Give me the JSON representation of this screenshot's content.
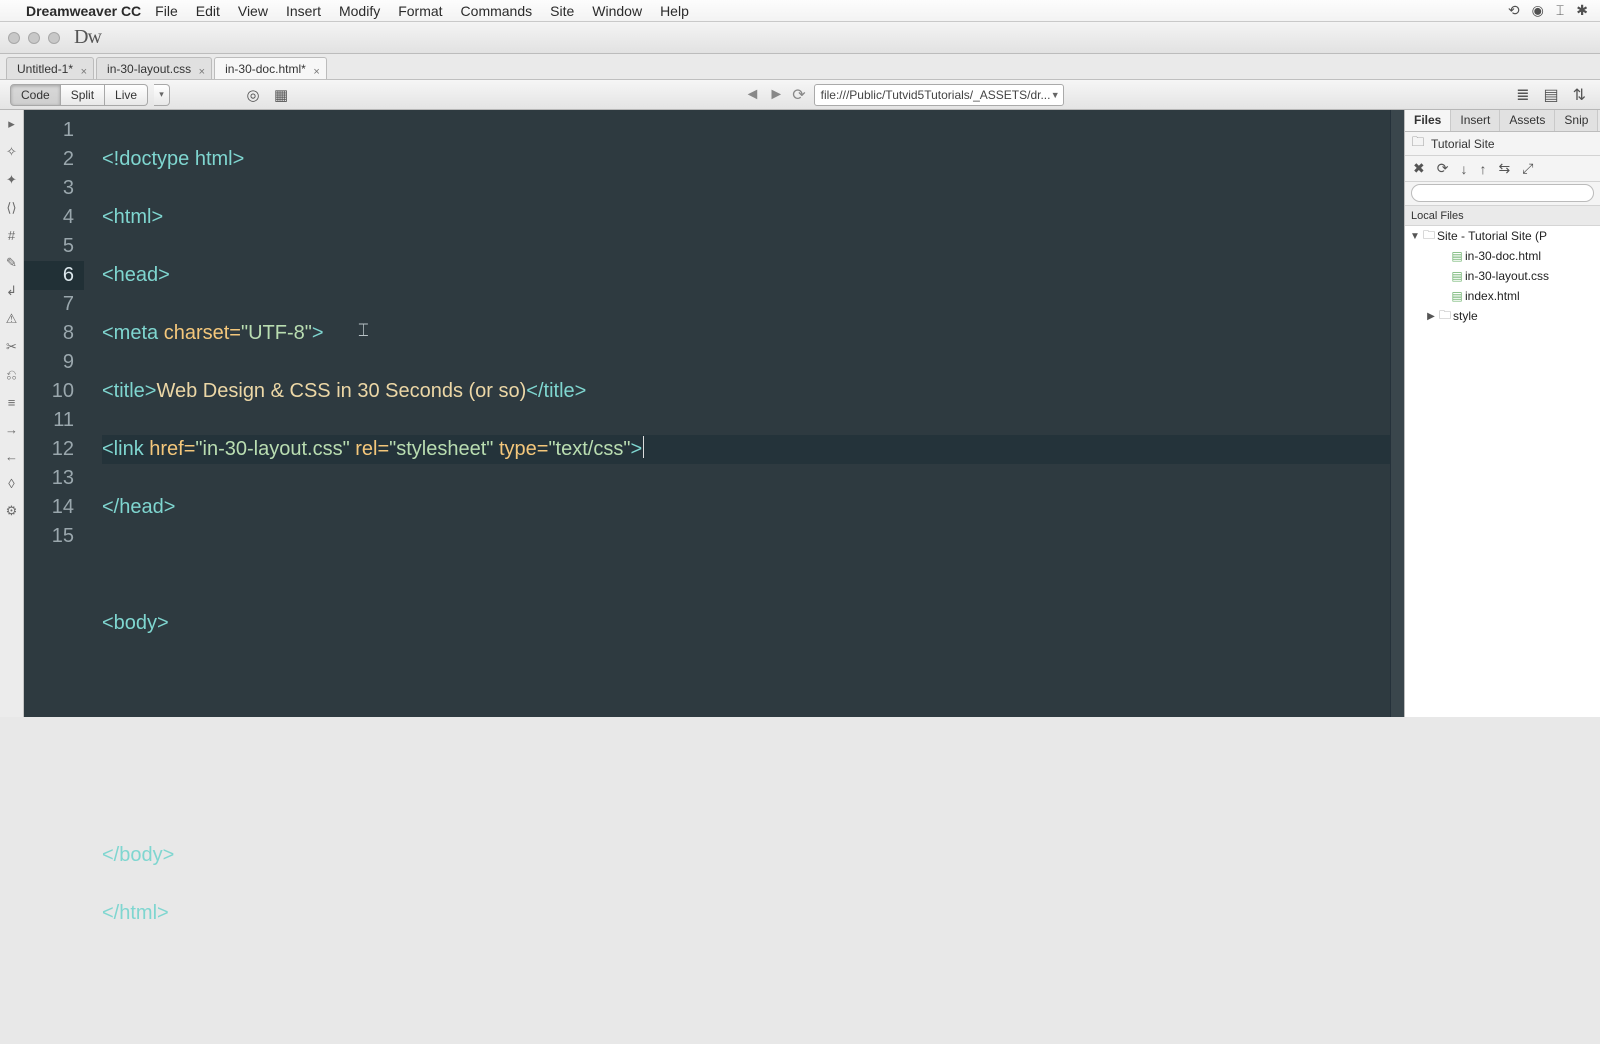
{
  "os_menu": {
    "app_name": "Dreamweaver CC",
    "items": [
      "File",
      "Edit",
      "View",
      "Insert",
      "Modify",
      "Format",
      "Commands",
      "Site",
      "Window",
      "Help"
    ]
  },
  "app_logo": "Dw",
  "doc_tabs": [
    {
      "label": "Untitled-1*",
      "active": false
    },
    {
      "label": "in-30-layout.css",
      "active": false
    },
    {
      "label": "in-30-doc.html*",
      "active": true
    }
  ],
  "view_buttons": {
    "code": "Code",
    "split": "Split",
    "live": "Live"
  },
  "address_bar": "file:///Public/Tutvid5Tutorials/_ASSETS/dr...",
  "editor": {
    "current_line": 6,
    "total_lines": 15
  },
  "code": {
    "l1_tag": "<!doctype html>",
    "l2_tag": "<html>",
    "l3_tag": "<head>",
    "l4_open": "<meta ",
    "l4_attr": "charset=",
    "l4_str": "\"UTF-8\"",
    "l4_close": ">",
    "l5_open": "<title>",
    "l5_text": "Web Design & CSS in 30 Seconds (or so)",
    "l5_close": "</title>",
    "l6_open": "<link ",
    "l6_a1": "href=",
    "l6_s1": "\"in-30-layout.css\"",
    "l6_a2": " rel=",
    "l6_s2": "\"stylesheet\"",
    "l6_a3": " type=",
    "l6_s3": "\"text/css\"",
    "l6_close": ">",
    "l7": "</head>",
    "l9": "<body>",
    "l13": "</body>",
    "l14": "</html>"
  },
  "panel": {
    "tabs": [
      "Files",
      "Insert",
      "Assets",
      "Snip"
    ],
    "site_label": "Tutorial Site",
    "header": "Local Files",
    "root_label": "Site - Tutorial Site (P",
    "files": [
      {
        "name": "in-30-doc.html",
        "type": "file"
      },
      {
        "name": "in-30-layout.css",
        "type": "file"
      },
      {
        "name": "index.html",
        "type": "file"
      },
      {
        "name": "style",
        "type": "folder"
      }
    ]
  }
}
